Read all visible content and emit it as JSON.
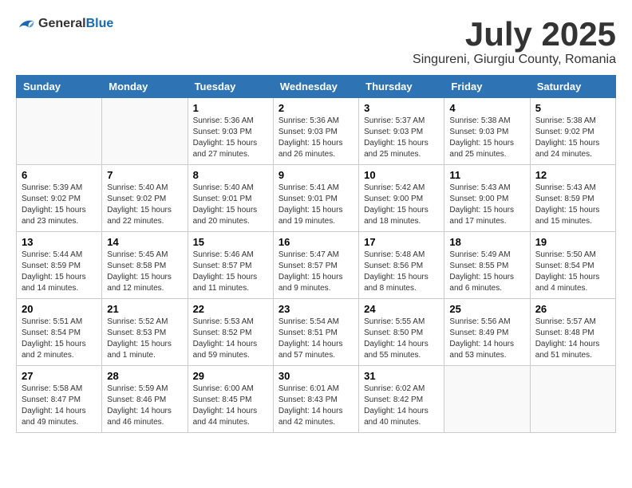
{
  "logo": {
    "general": "General",
    "blue": "Blue"
  },
  "title": "July 2025",
  "subtitle": "Singureni, Giurgiu County, Romania",
  "headers": [
    "Sunday",
    "Monday",
    "Tuesday",
    "Wednesday",
    "Thursday",
    "Friday",
    "Saturday"
  ],
  "weeks": [
    [
      {
        "day": "",
        "info": ""
      },
      {
        "day": "",
        "info": ""
      },
      {
        "day": "1",
        "info": "Sunrise: 5:36 AM\nSunset: 9:03 PM\nDaylight: 15 hours\nand 27 minutes."
      },
      {
        "day": "2",
        "info": "Sunrise: 5:36 AM\nSunset: 9:03 PM\nDaylight: 15 hours\nand 26 minutes."
      },
      {
        "day": "3",
        "info": "Sunrise: 5:37 AM\nSunset: 9:03 PM\nDaylight: 15 hours\nand 25 minutes."
      },
      {
        "day": "4",
        "info": "Sunrise: 5:38 AM\nSunset: 9:03 PM\nDaylight: 15 hours\nand 25 minutes."
      },
      {
        "day": "5",
        "info": "Sunrise: 5:38 AM\nSunset: 9:02 PM\nDaylight: 15 hours\nand 24 minutes."
      }
    ],
    [
      {
        "day": "6",
        "info": "Sunrise: 5:39 AM\nSunset: 9:02 PM\nDaylight: 15 hours\nand 23 minutes."
      },
      {
        "day": "7",
        "info": "Sunrise: 5:40 AM\nSunset: 9:02 PM\nDaylight: 15 hours\nand 22 minutes."
      },
      {
        "day": "8",
        "info": "Sunrise: 5:40 AM\nSunset: 9:01 PM\nDaylight: 15 hours\nand 20 minutes."
      },
      {
        "day": "9",
        "info": "Sunrise: 5:41 AM\nSunset: 9:01 PM\nDaylight: 15 hours\nand 19 minutes."
      },
      {
        "day": "10",
        "info": "Sunrise: 5:42 AM\nSunset: 9:00 PM\nDaylight: 15 hours\nand 18 minutes."
      },
      {
        "day": "11",
        "info": "Sunrise: 5:43 AM\nSunset: 9:00 PM\nDaylight: 15 hours\nand 17 minutes."
      },
      {
        "day": "12",
        "info": "Sunrise: 5:43 AM\nSunset: 8:59 PM\nDaylight: 15 hours\nand 15 minutes."
      }
    ],
    [
      {
        "day": "13",
        "info": "Sunrise: 5:44 AM\nSunset: 8:59 PM\nDaylight: 15 hours\nand 14 minutes."
      },
      {
        "day": "14",
        "info": "Sunrise: 5:45 AM\nSunset: 8:58 PM\nDaylight: 15 hours\nand 12 minutes."
      },
      {
        "day": "15",
        "info": "Sunrise: 5:46 AM\nSunset: 8:57 PM\nDaylight: 15 hours\nand 11 minutes."
      },
      {
        "day": "16",
        "info": "Sunrise: 5:47 AM\nSunset: 8:57 PM\nDaylight: 15 hours\nand 9 minutes."
      },
      {
        "day": "17",
        "info": "Sunrise: 5:48 AM\nSunset: 8:56 PM\nDaylight: 15 hours\nand 8 minutes."
      },
      {
        "day": "18",
        "info": "Sunrise: 5:49 AM\nSunset: 8:55 PM\nDaylight: 15 hours\nand 6 minutes."
      },
      {
        "day": "19",
        "info": "Sunrise: 5:50 AM\nSunset: 8:54 PM\nDaylight: 15 hours\nand 4 minutes."
      }
    ],
    [
      {
        "day": "20",
        "info": "Sunrise: 5:51 AM\nSunset: 8:54 PM\nDaylight: 15 hours\nand 2 minutes."
      },
      {
        "day": "21",
        "info": "Sunrise: 5:52 AM\nSunset: 8:53 PM\nDaylight: 15 hours\nand 1 minute."
      },
      {
        "day": "22",
        "info": "Sunrise: 5:53 AM\nSunset: 8:52 PM\nDaylight: 14 hours\nand 59 minutes."
      },
      {
        "day": "23",
        "info": "Sunrise: 5:54 AM\nSunset: 8:51 PM\nDaylight: 14 hours\nand 57 minutes."
      },
      {
        "day": "24",
        "info": "Sunrise: 5:55 AM\nSunset: 8:50 PM\nDaylight: 14 hours\nand 55 minutes."
      },
      {
        "day": "25",
        "info": "Sunrise: 5:56 AM\nSunset: 8:49 PM\nDaylight: 14 hours\nand 53 minutes."
      },
      {
        "day": "26",
        "info": "Sunrise: 5:57 AM\nSunset: 8:48 PM\nDaylight: 14 hours\nand 51 minutes."
      }
    ],
    [
      {
        "day": "27",
        "info": "Sunrise: 5:58 AM\nSunset: 8:47 PM\nDaylight: 14 hours\nand 49 minutes."
      },
      {
        "day": "28",
        "info": "Sunrise: 5:59 AM\nSunset: 8:46 PM\nDaylight: 14 hours\nand 46 minutes."
      },
      {
        "day": "29",
        "info": "Sunrise: 6:00 AM\nSunset: 8:45 PM\nDaylight: 14 hours\nand 44 minutes."
      },
      {
        "day": "30",
        "info": "Sunrise: 6:01 AM\nSunset: 8:43 PM\nDaylight: 14 hours\nand 42 minutes."
      },
      {
        "day": "31",
        "info": "Sunrise: 6:02 AM\nSunset: 8:42 PM\nDaylight: 14 hours\nand 40 minutes."
      },
      {
        "day": "",
        "info": ""
      },
      {
        "day": "",
        "info": ""
      }
    ]
  ]
}
